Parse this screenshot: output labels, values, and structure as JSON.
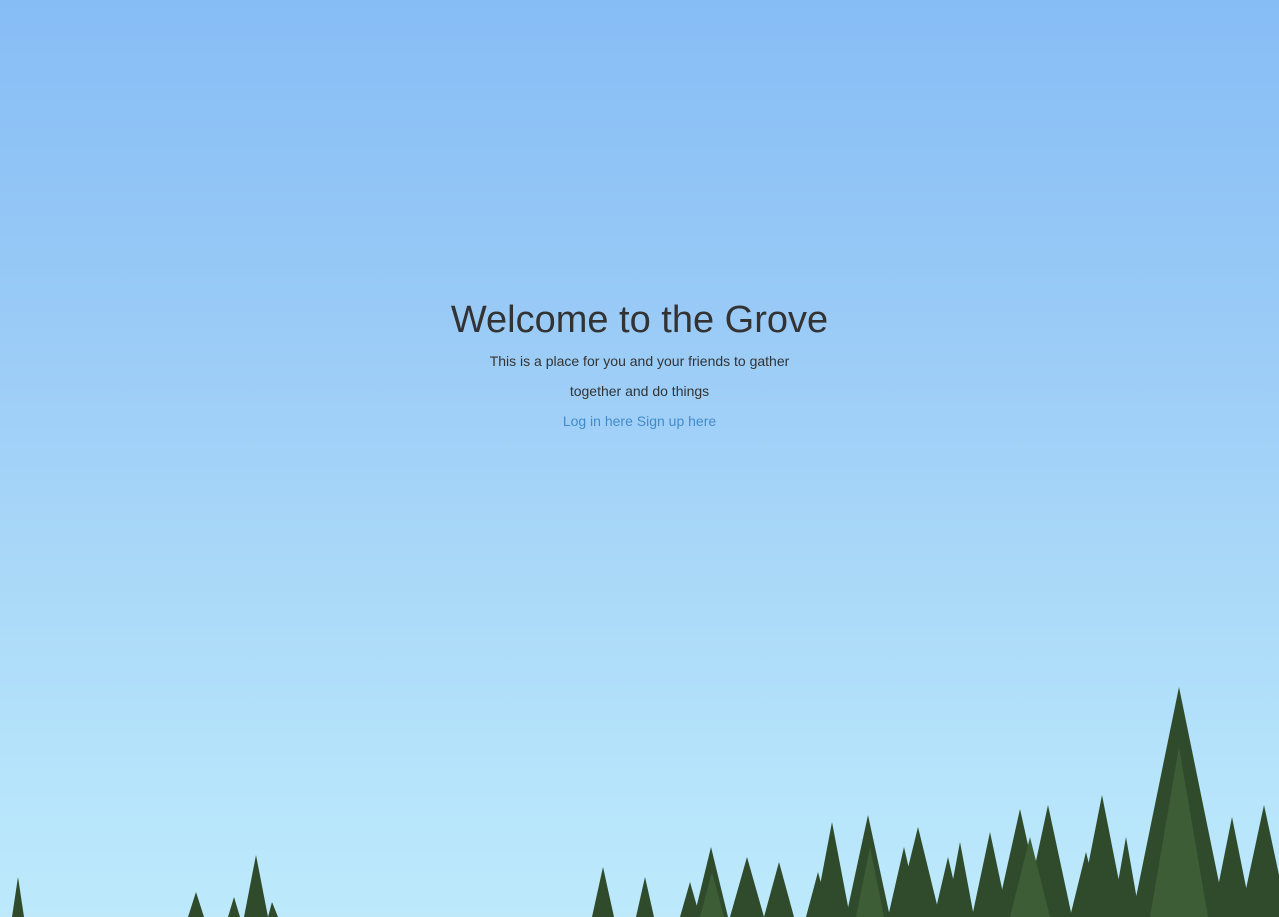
{
  "hero": {
    "title": "Welcome to the Grove",
    "tagline": "This is a place for you and your friends to gather together and do things",
    "login_link": "Log in here",
    "signup_link": "Sign up here"
  },
  "colors": {
    "sky_top": "#86bdf5",
    "sky_bottom": "#bde9fb",
    "text": "#333333",
    "link": "#428bca",
    "trees": "#2e4a2c"
  }
}
